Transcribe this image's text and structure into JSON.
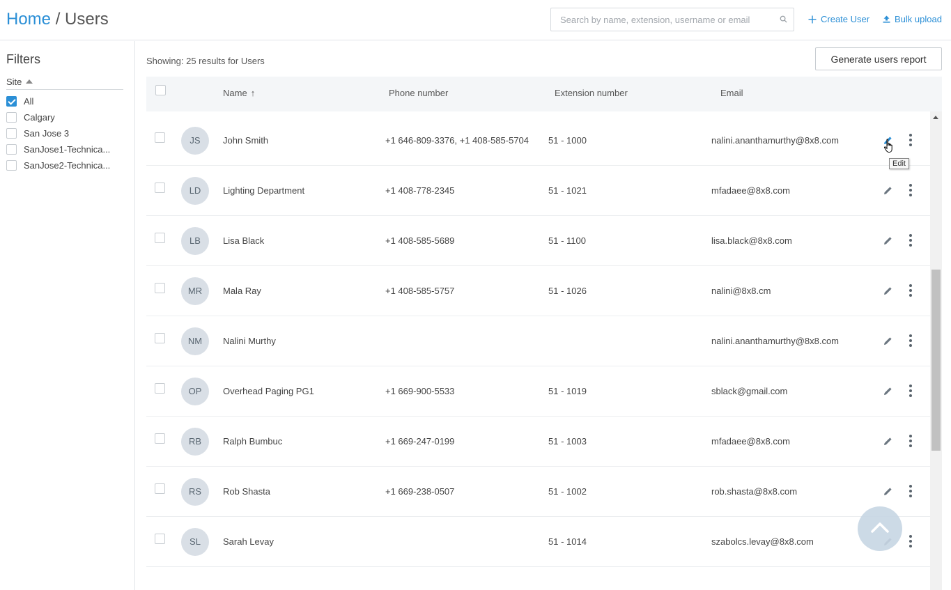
{
  "header": {
    "breadcrumb_home": "Home",
    "breadcrumb_sep": "/",
    "breadcrumb_current": "Users",
    "search_placeholder": "Search by name, extension, username or email",
    "create_user_label": "Create User",
    "bulk_upload_label": "Bulk upload"
  },
  "sidebar": {
    "title": "Filters",
    "site_label": "Site",
    "items": [
      {
        "label": "All",
        "checked": true
      },
      {
        "label": "Calgary",
        "checked": false
      },
      {
        "label": "San Jose 3",
        "checked": false
      },
      {
        "label": "SanJose1-Technica...",
        "checked": false
      },
      {
        "label": "SanJose2-Technica...",
        "checked": false
      }
    ]
  },
  "main": {
    "showing_text": "Showing: 25 results for Users",
    "report_button": "Generate users report",
    "columns": {
      "name": "Name",
      "name_sort": "↑",
      "phone": "Phone number",
      "extension": "Extension number",
      "email": "Email"
    },
    "rows": [
      {
        "initials": "JS",
        "name": "John Smith",
        "phone": "+1 646-809-3376, +1 408-585-5704",
        "ext": "51 - 1000",
        "email": "nalini.ananthamurthy@8x8.com"
      },
      {
        "initials": "LD",
        "name": "Lighting Department",
        "phone": "+1 408-778-2345",
        "ext": "51 - 1021",
        "email": "mfadaee@8x8.com"
      },
      {
        "initials": "LB",
        "name": "Lisa Black",
        "phone": "+1 408-585-5689",
        "ext": "51 - 1100",
        "email": "lisa.black@8x8.com"
      },
      {
        "initials": "MR",
        "name": "Mala Ray",
        "phone": "+1 408-585-5757",
        "ext": "51 - 1026",
        "email": "nalini@8x8.cm"
      },
      {
        "initials": "NM",
        "name": "Nalini Murthy",
        "phone": "",
        "ext": "",
        "email": "nalini.ananthamurthy@8x8.com"
      },
      {
        "initials": "OP",
        "name": "Overhead Paging PG1",
        "phone": "+1 669-900-5533",
        "ext": "51 - 1019",
        "email": "sblack@gmail.com"
      },
      {
        "initials": "RB",
        "name": "Ralph Bumbuc",
        "phone": "+1 669-247-0199",
        "ext": "51 - 1003",
        "email": "mfadaee@8x8.com"
      },
      {
        "initials": "RS",
        "name": "Rob Shasta",
        "phone": "+1 669-238-0507",
        "ext": "51 - 1002",
        "email": "rob.shasta@8x8.com"
      },
      {
        "initials": "SL",
        "name": "Sarah Levay",
        "phone": "",
        "ext": "51 - 1014",
        "email": "szabolcs.levay@8x8.com"
      }
    ],
    "tooltip": "Edit"
  },
  "icons": {
    "search": "search-icon",
    "create": "plus-icon",
    "bulk": "upload-icon",
    "edit": "pencil-icon",
    "more": "more-vertical-icon",
    "scroll_top": "chevron-up-icon"
  },
  "colors": {
    "accent": "#2b8fd6",
    "avatar_bg": "#d9dfe6",
    "header_bg": "#f4f6f8"
  }
}
